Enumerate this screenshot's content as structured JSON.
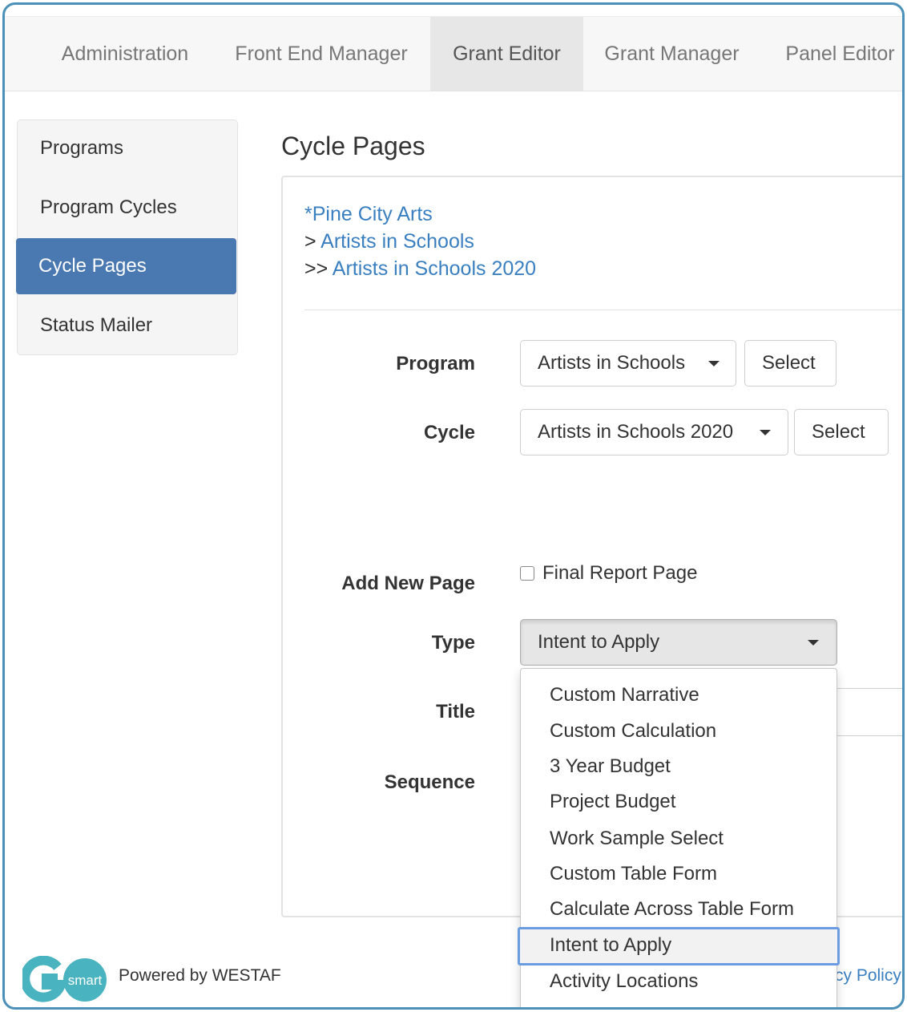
{
  "topnav": {
    "tabs": [
      {
        "label": "Administration"
      },
      {
        "label": "Front End Manager"
      },
      {
        "label": "Grant Editor"
      },
      {
        "label": "Grant Manager"
      },
      {
        "label": "Panel Editor"
      }
    ],
    "active_tab": "Grant Editor"
  },
  "sidebar": {
    "items": [
      {
        "label": "Programs"
      },
      {
        "label": "Program Cycles"
      },
      {
        "label": "Cycle Pages"
      },
      {
        "label": "Status Mailer"
      }
    ],
    "active_item": "Cycle Pages"
  },
  "main": {
    "title": "Cycle Pages",
    "breadcrumb": {
      "organization": "*Pine City Arts",
      "program_prefix": "> ",
      "program": "Artists in Schools",
      "cycle_prefix": ">> ",
      "cycle": "Artists in Schools 2020"
    },
    "program_row": {
      "label": "Program",
      "value": "Artists in Schools",
      "button": "Select"
    },
    "cycle_row": {
      "label": "Cycle",
      "value": "Artists in Schools 2020",
      "button": "Select"
    },
    "add_new_page": {
      "label": "Add New Page",
      "checkbox_label": "Final Report Page",
      "checked": false
    },
    "type_row": {
      "label": "Type",
      "value": "Intent to Apply"
    },
    "title_row": {
      "label": "Title"
    },
    "sequence_row": {
      "label": "Sequence"
    }
  },
  "type_menu": {
    "options": [
      "Custom Narrative",
      "Custom Calculation",
      "3 Year Budget",
      "Project Budget",
      "Work Sample Select",
      "Custom Table Form",
      "Calculate Across Table Form",
      "Intent to Apply",
      "Activity Locations"
    ],
    "selected": "Intent to Apply"
  },
  "footer": {
    "logo_text": "smart",
    "powered_by": "Powered by WESTAF",
    "policy_link": "cy Policy"
  },
  "colors": {
    "accent": "#4a78b0",
    "link": "#3a7fc0",
    "frame_border": "#4a90b8",
    "logo_teal": "#4ab3c0"
  }
}
